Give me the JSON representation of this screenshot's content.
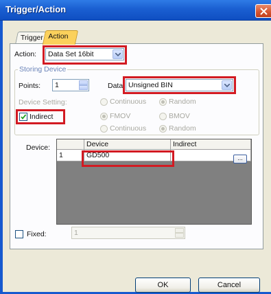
{
  "window": {
    "title": "Trigger/Action",
    "close_glyph": "✕"
  },
  "tabs": [
    {
      "label": "Trigger",
      "active": false
    },
    {
      "label": "Action",
      "active": true
    }
  ],
  "action": {
    "label": "Action:",
    "value": "Data Set 16bit"
  },
  "storing_device": {
    "group_title": "Storing Device",
    "points_label": "Points:",
    "points_value": "1",
    "data_label": "Data:",
    "data_value": "Unsigned BIN",
    "device_setting_label": "Device Setting:",
    "indirect_label": "Indirect",
    "indirect_checked": true,
    "radio_options": [
      {
        "label": "Continuous",
        "selected": false
      },
      {
        "label": "Random",
        "selected": true
      },
      {
        "label": "FMOV",
        "selected": true
      },
      {
        "label": "BMOV",
        "selected": false
      },
      {
        "label": "Continuous",
        "selected": false
      },
      {
        "label": "Random",
        "selected": true
      }
    ]
  },
  "device_table": {
    "label": "Device:",
    "columns": [
      "",
      "Device",
      "Indirect"
    ],
    "rows": [
      {
        "no": "1",
        "device": "GD500",
        "indirect": ""
      }
    ],
    "ellipsis_label": "..."
  },
  "fixed": {
    "label": "Fixed:",
    "checked": false,
    "value": "1"
  },
  "buttons": {
    "ok": "OK",
    "cancel": "Cancel"
  },
  "colors": {
    "title_bar": "#1a5fd1",
    "highlight": "#d21a22",
    "active_tab": "#fbd15c"
  }
}
